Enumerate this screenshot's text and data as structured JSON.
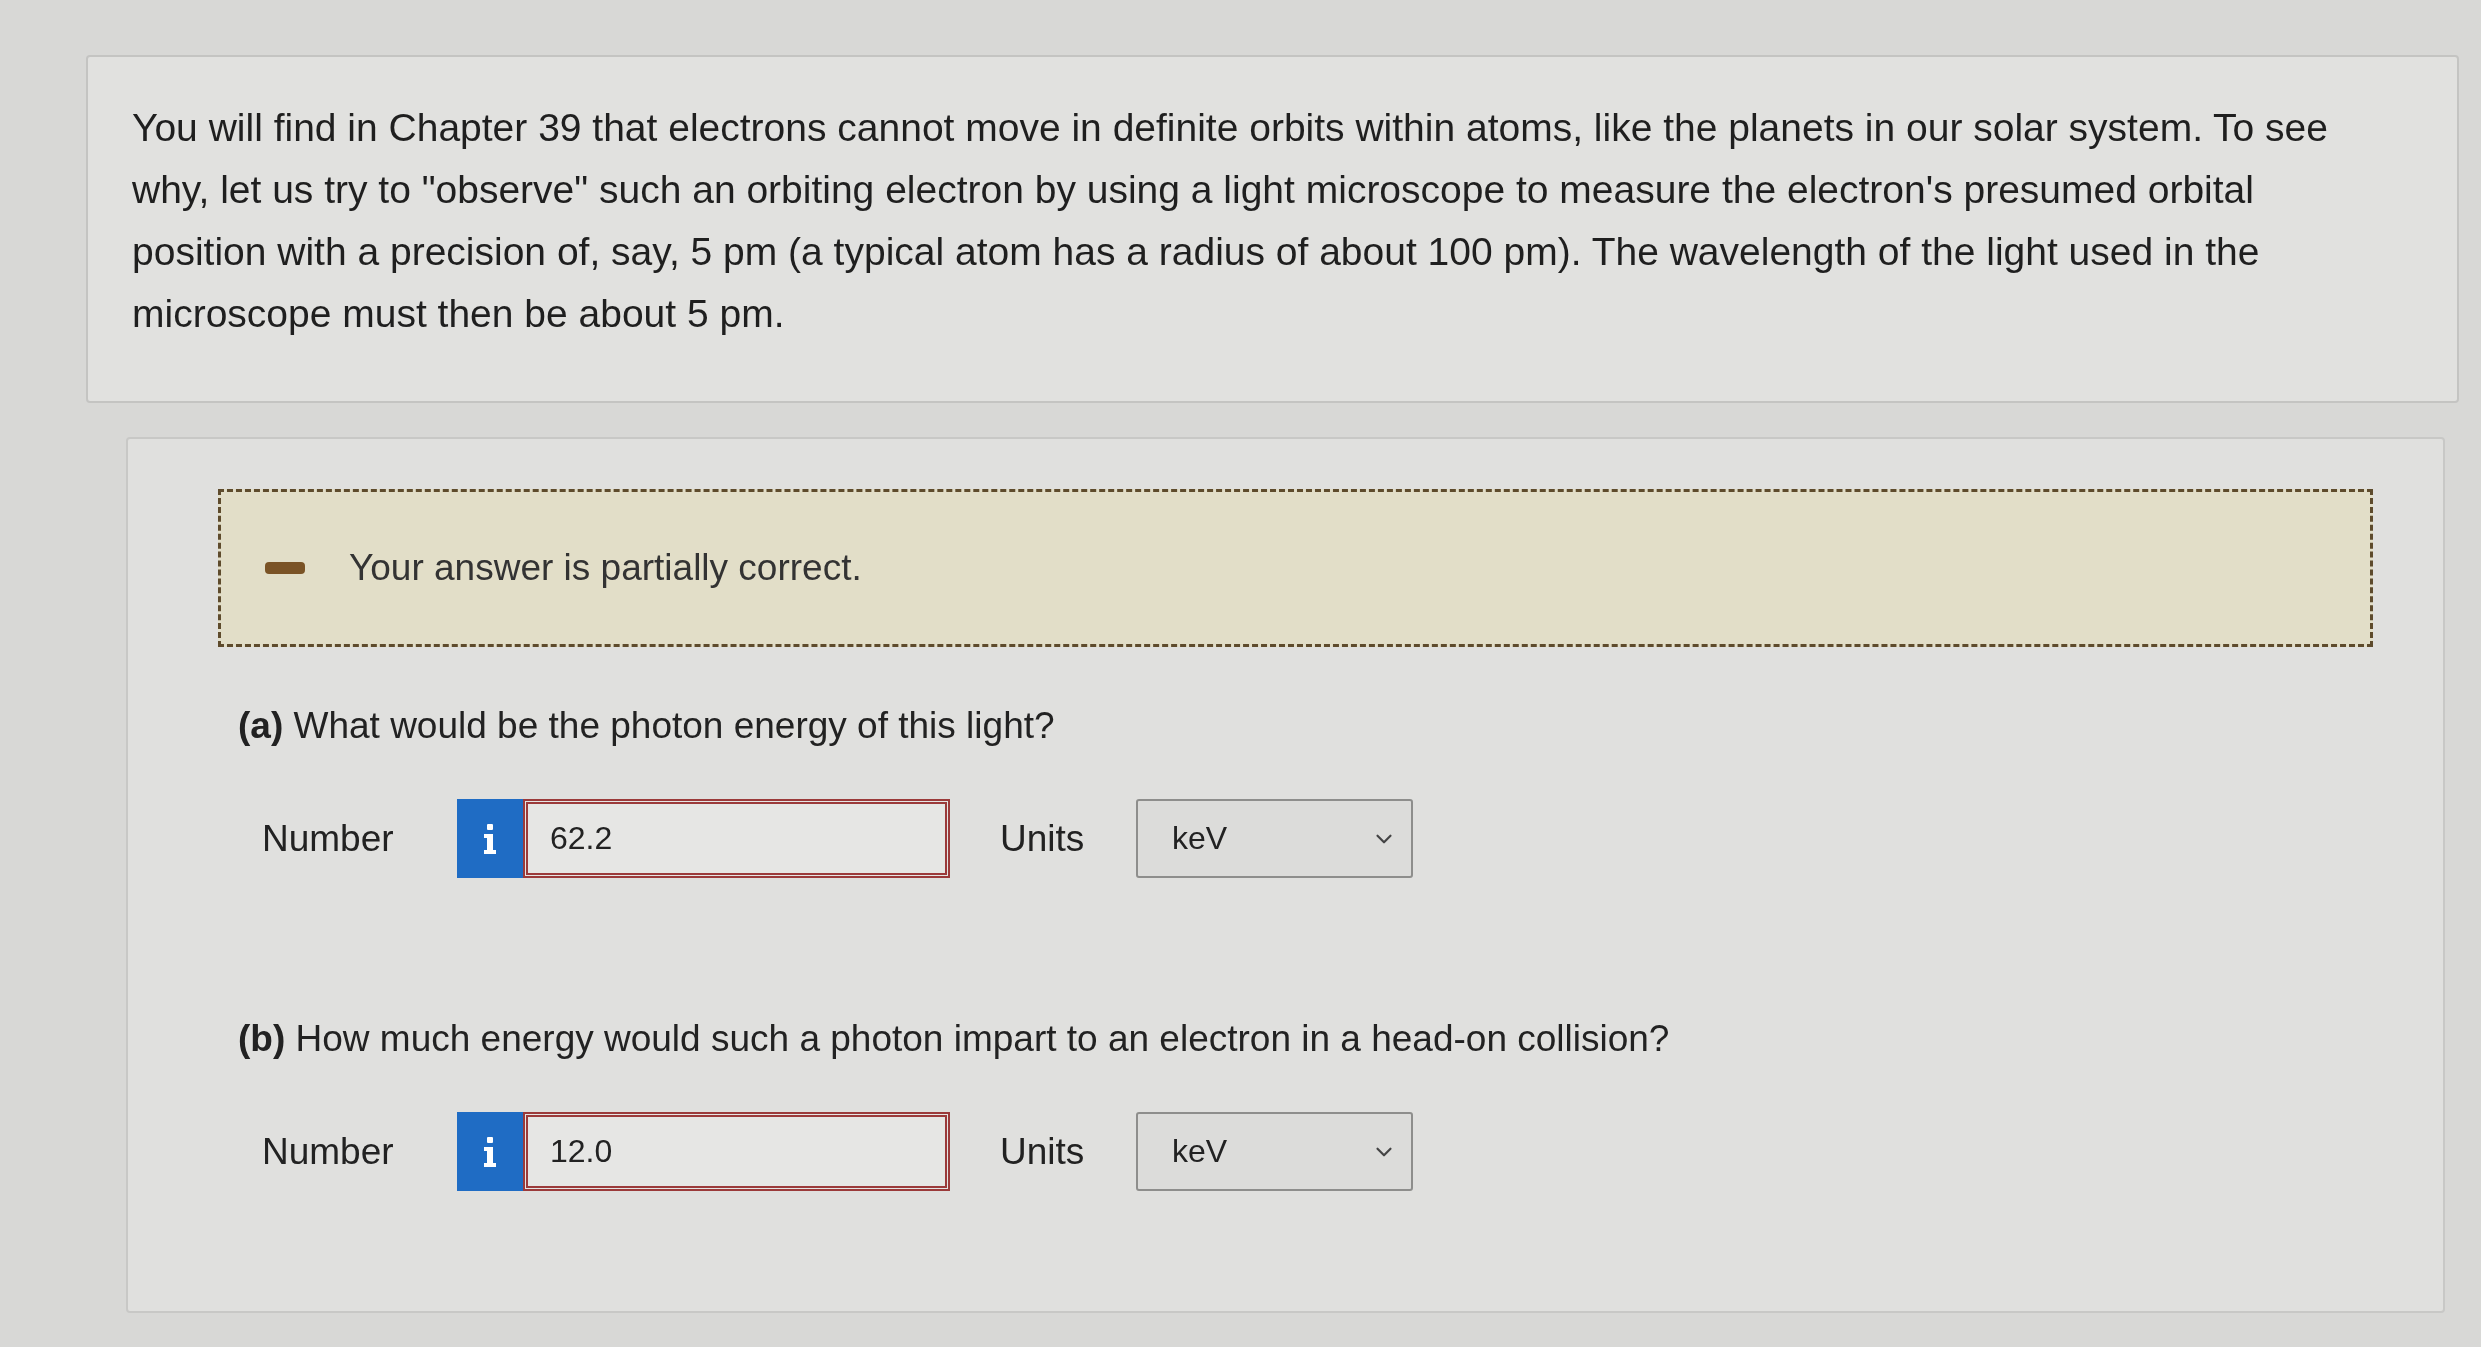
{
  "problem": {
    "text": "You will find in Chapter 39 that electrons cannot move in definite orbits within atoms, like the planets in our solar system. To see why, let us try to \"observe\" such an orbiting electron by using a light microscope to measure the electron's presumed orbital position with a precision of, say, 5 pm (a typical atom has a radius of about 100 pm). The wavelength of the light used in the microscope must then be about 5 pm."
  },
  "feedback": {
    "kind": "partial",
    "message": "Your answer is partially correct."
  },
  "parts": [
    {
      "question": "**(a)** What would be the photon energy of this light?",
      "number_label": "Number",
      "value": "62.2",
      "correct": false,
      "units_label": "Units",
      "unit": "keV"
    },
    {
      "question": "**(b)** How much energy would such a photon impart to an electron in a head-on collision?",
      "number_label": "Number",
      "value": "12.0",
      "correct": false,
      "units_label": "Units",
      "unit": "keV"
    }
  ]
}
